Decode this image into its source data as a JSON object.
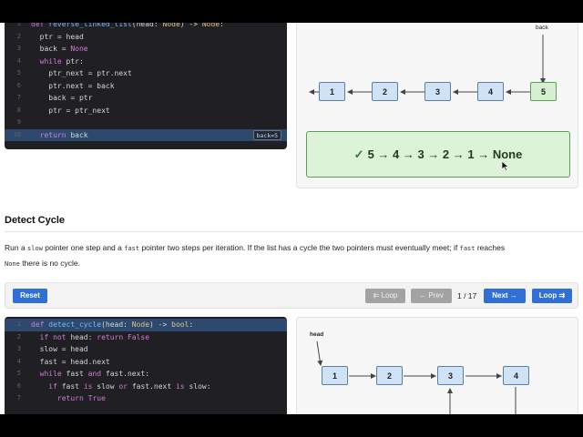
{
  "reverse": {
    "code": [
      {
        "n": "1",
        "parts": [
          [
            "kw",
            "def "
          ],
          [
            "fn",
            "reverse_linked_list"
          ],
          [
            "",
            "(head: "
          ],
          [
            "nm",
            "Node"
          ],
          [
            "",
            ") -> "
          ],
          [
            "nm",
            "Node"
          ],
          [
            "",
            ":"
          ]
        ]
      },
      {
        "n": "2",
        "parts": [
          [
            "",
            "  ptr = head"
          ]
        ]
      },
      {
        "n": "3",
        "parts": [
          [
            "",
            "  back = "
          ],
          [
            "kw",
            "None"
          ]
        ]
      },
      {
        "n": "4",
        "parts": [
          [
            "",
            "  "
          ],
          [
            "kw",
            "while "
          ],
          [
            "",
            "ptr:"
          ]
        ]
      },
      {
        "n": "5",
        "parts": [
          [
            "",
            "    ptr_next = ptr.next"
          ]
        ]
      },
      {
        "n": "6",
        "parts": [
          [
            "",
            "    ptr.next = back"
          ]
        ]
      },
      {
        "n": "7",
        "parts": [
          [
            "",
            "    back = ptr"
          ]
        ]
      },
      {
        "n": "8",
        "parts": [
          [
            "",
            "    ptr = ptr_next"
          ]
        ]
      },
      {
        "n": "9",
        "parts": [
          [
            "",
            ""
          ]
        ]
      },
      {
        "n": "10",
        "parts": [
          [
            "",
            "  "
          ],
          [
            "kw",
            "return "
          ],
          [
            "",
            "back"
          ]
        ]
      }
    ],
    "var_tag": "back=5",
    "pointer_label": "back",
    "nodes": [
      "1",
      "2",
      "3",
      "4",
      "5"
    ],
    "result": {
      "check": "✓",
      "text": "5 → 4 → 3 → 2 → 1 → None"
    }
  },
  "section": {
    "title": "Detect Cycle",
    "desc_1": "Run a ",
    "desc_slow": "slow",
    "desc_2": " pointer one step and a ",
    "desc_fast": "fast",
    "desc_3": " pointer two steps per iteration. If the list has a cycle the two pointers must eventually meet; if ",
    "desc_fast2": "fast",
    "desc_4": " reaches",
    "desc_none": "None",
    "desc_5": " there is no cycle."
  },
  "toolbar": {
    "reset": "Reset",
    "loop_back": "⇇ Loop",
    "prev": "← Prev",
    "counter": "1 / 17",
    "next": "Next →",
    "loop_fwd": "Loop ⇉"
  },
  "cycle": {
    "code": [
      {
        "n": "1",
        "parts": [
          [
            "kw",
            "def "
          ],
          [
            "fn",
            "detect_cycle"
          ],
          [
            "",
            "(head: "
          ],
          [
            "nm",
            "Node"
          ],
          [
            "",
            ") -> "
          ],
          [
            "nm",
            "bool"
          ],
          [
            "",
            ":"
          ]
        ]
      },
      {
        "n": "2",
        "parts": [
          [
            "",
            "  "
          ],
          [
            "kw",
            "if not "
          ],
          [
            "",
            "head: "
          ],
          [
            "kw",
            "return "
          ],
          [
            "kw",
            "False"
          ]
        ]
      },
      {
        "n": "3",
        "parts": [
          [
            "",
            "  slow = head"
          ]
        ]
      },
      {
        "n": "4",
        "parts": [
          [
            "",
            "  fast = head.next"
          ]
        ]
      },
      {
        "n": "5",
        "parts": [
          [
            "",
            "  "
          ],
          [
            "kw",
            "while "
          ],
          [
            "",
            "fast "
          ],
          [
            "kw",
            "and "
          ],
          [
            "",
            "fast.next:"
          ]
        ]
      },
      {
        "n": "6",
        "parts": [
          [
            "",
            "    "
          ],
          [
            "kw",
            "if "
          ],
          [
            "",
            "fast "
          ],
          [
            "kw",
            "is "
          ],
          [
            "",
            "slow "
          ],
          [
            "kw",
            "or "
          ],
          [
            "",
            "fast.next "
          ],
          [
            "kw",
            "is "
          ],
          [
            "",
            "slow:"
          ]
        ]
      },
      {
        "n": "7",
        "parts": [
          [
            "",
            "      "
          ],
          [
            "kw",
            "return "
          ],
          [
            "kw",
            "True"
          ]
        ]
      }
    ],
    "pointer_label": "head",
    "nodes": [
      "1",
      "2",
      "3",
      "4"
    ]
  }
}
